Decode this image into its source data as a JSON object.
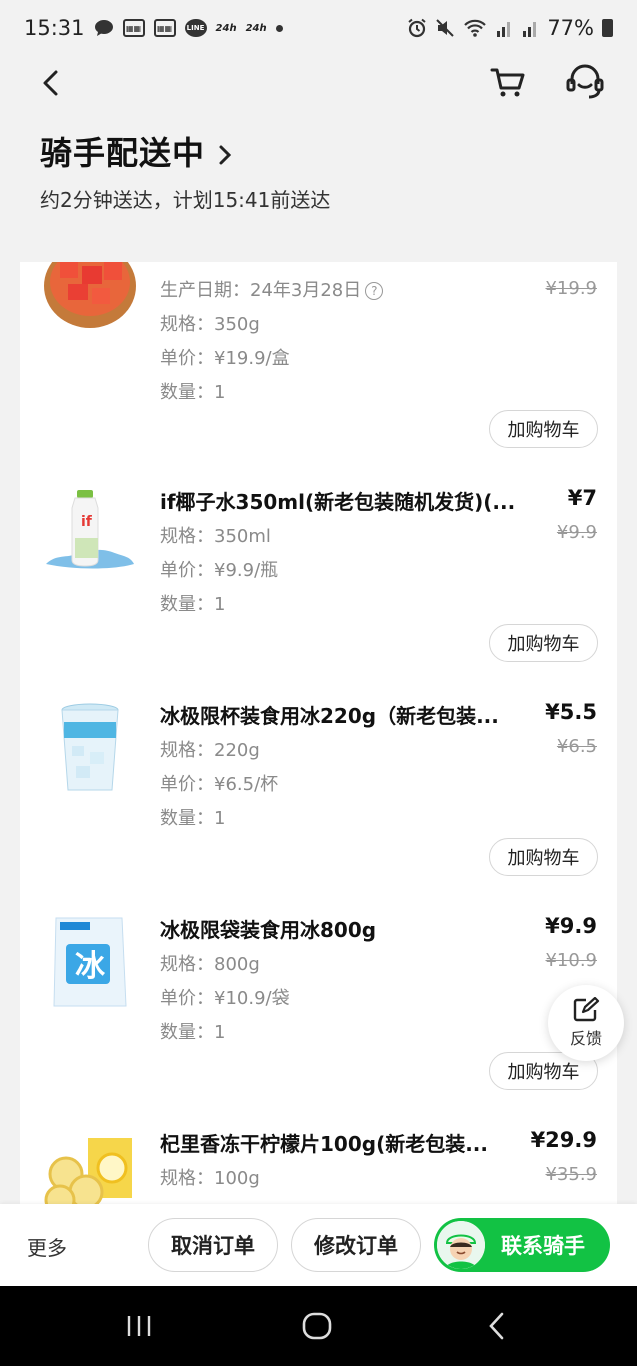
{
  "status_bar": {
    "time": "15:31",
    "app_icons": [
      "chat-bubble-icon",
      "news-icon",
      "news-icon",
      "line-icon",
      "24h-icon",
      "24h-icon"
    ],
    "label_24h": "24h",
    "label_line": "LINE",
    "label_box": "▦▦",
    "battery": "77%"
  },
  "header": {
    "title": "骑手配送中",
    "subtitle": "约2分钟送达，计划15:41前送达"
  },
  "items": [
    {
      "name": "",
      "price": "",
      "original_price": "¥19.9",
      "line1": "生产日期：24年3月28日",
      "line2": "规格：350g",
      "line3": "单价：¥19.9/盒",
      "line4": "数量：1",
      "button": "加购物车",
      "icon": "watermelon-image"
    },
    {
      "name": "if椰子水350ml(新老包装随机发货)(...",
      "price": "¥7",
      "original_price": "¥9.9",
      "line1": "规格：350ml",
      "line2": "单价：¥9.9/瓶",
      "line3": "数量：1",
      "button": "加购物车",
      "icon": "coconut-water-image"
    },
    {
      "name": "冰极限杯装食用冰220g（新老包装...",
      "price": "¥5.5",
      "original_price": "¥6.5",
      "line1": "规格：220g",
      "line2": "单价：¥6.5/杯",
      "line3": "数量：1",
      "button": "加购物车",
      "icon": "ice-cup-image"
    },
    {
      "name": "冰极限袋装食用冰800g",
      "price": "¥9.9",
      "original_price": "¥10.9",
      "line1": "规格：800g",
      "line2": "单价：¥10.9/袋",
      "line3": "数量：1",
      "button": "加购物车",
      "icon": "ice-bag-image",
      "bag_text": "冰"
    },
    {
      "name": "杞里香冻干柠檬片100g(新老包装...",
      "price": "¥29.9",
      "original_price": "¥35.9",
      "line1": "规格：100g",
      "icon": "lemon-slices-image"
    }
  ],
  "feedback": {
    "label": "反馈"
  },
  "bottom_bar": {
    "more": "更多",
    "cancel": "取消订单",
    "modify": "修改订单",
    "contact": "联系骑手"
  },
  "colors": {
    "accent": "#12c244",
    "background": "#f2f2f2",
    "muted_text": "#8a8a8a"
  }
}
